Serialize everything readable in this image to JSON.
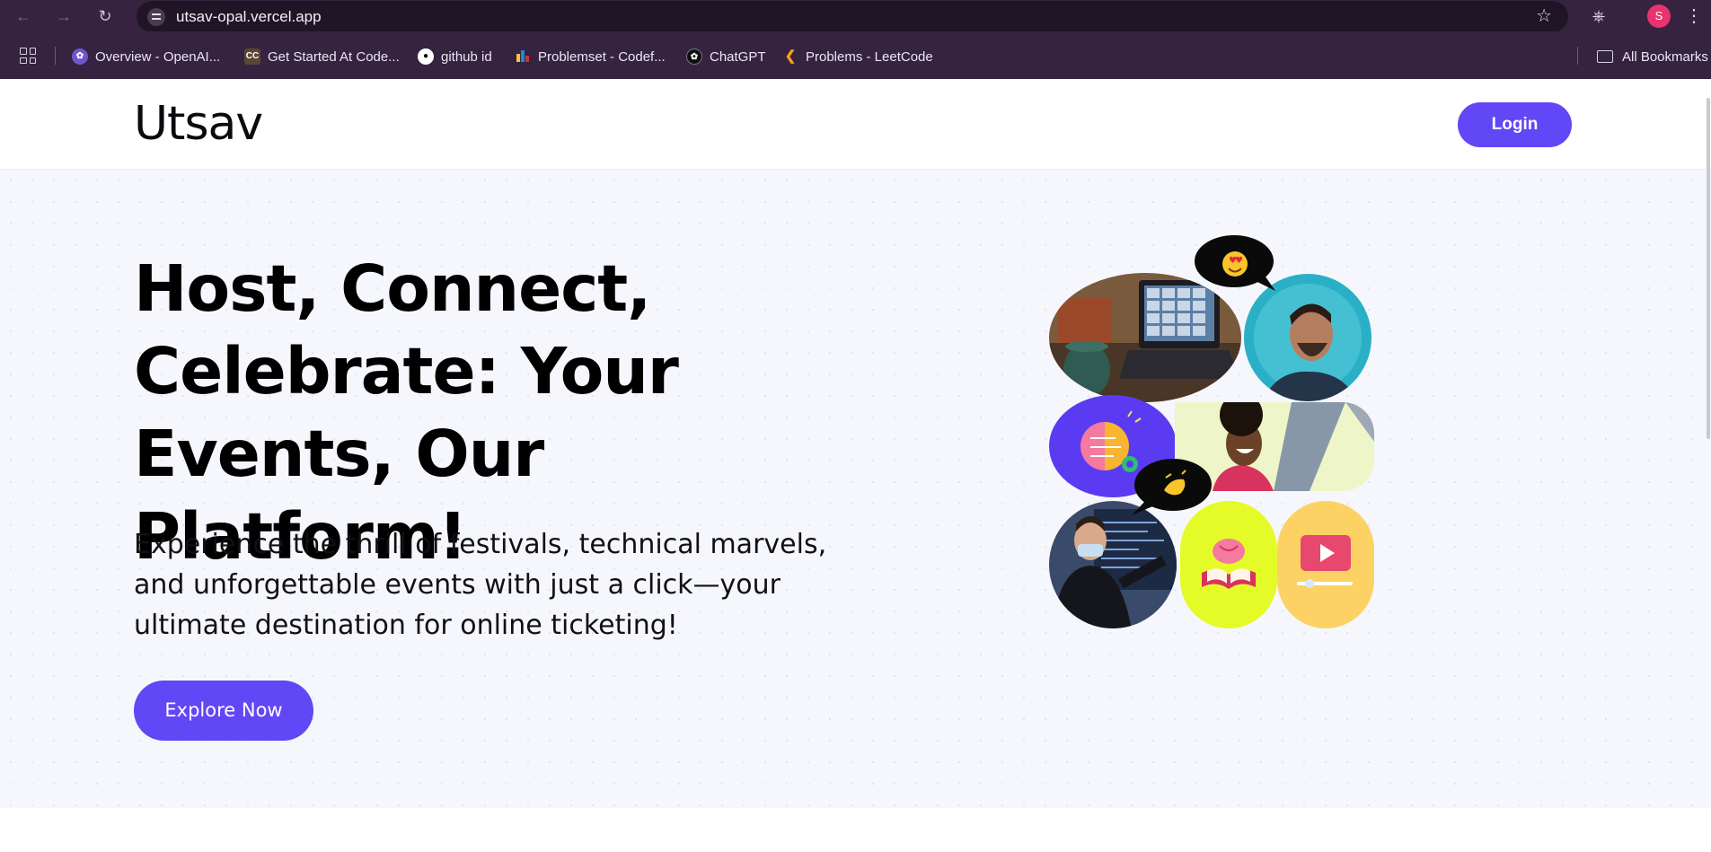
{
  "browser": {
    "url": "utsav-opal.vercel.app",
    "profile_initial": "S",
    "bookmarks": [
      {
        "label": "Overview - OpenAI...",
        "icon": "openai-icon",
        "color": "#6e56cf"
      },
      {
        "label": "Get Started At Code...",
        "icon": "codechef-icon",
        "color": "#5b4636"
      },
      {
        "label": "github id",
        "icon": "github-icon",
        "color": "#ffffff"
      },
      {
        "label": "Problemset - Codef...",
        "icon": "codeforces-icon",
        "color": "#1f8acb"
      },
      {
        "label": "ChatGPT",
        "icon": "chatgpt-icon",
        "color": "#0f0f0f"
      },
      {
        "label": "Problems - LeetCode",
        "icon": "leetcode-icon",
        "color": "#f89f1b"
      }
    ],
    "all_bookmarks_label": "All Bookmarks"
  },
  "header": {
    "logo": "Utsav",
    "login_label": "Login"
  },
  "hero": {
    "headline_line1": "Host, Connect,",
    "headline_line2": "Celebrate: Your",
    "headline_line3": "Events, Our Platform!",
    "sub_line1": "Experience the thrill of festivals, technical marvels,",
    "sub_line2": "and unforgettable events with just a click—your",
    "sub_line3": "ultimate destination for online ticketing!",
    "cta_label": "Explore Now"
  },
  "colors": {
    "accent": "#6147f5",
    "hero_bg": "#f6f7fc",
    "chrome_bg": "#35233f"
  }
}
